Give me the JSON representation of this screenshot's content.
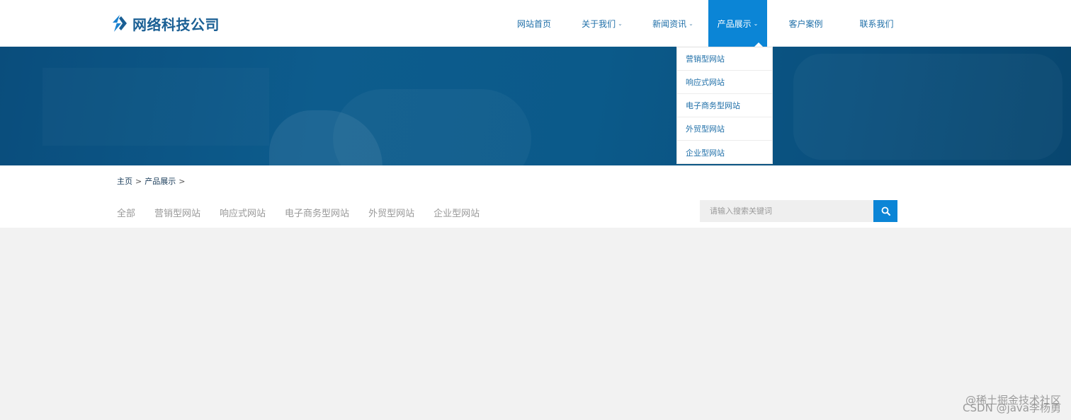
{
  "header": {
    "logo_text": "网络科技公司",
    "nav": [
      {
        "label": "网站首页",
        "chevron": false,
        "active": false
      },
      {
        "label": "关于我们",
        "chevron": true,
        "active": false
      },
      {
        "label": "新闻资讯",
        "chevron": true,
        "active": false
      },
      {
        "label": "产品展示",
        "chevron": true,
        "active": true
      },
      {
        "label": "客户案例",
        "chevron": false,
        "active": false
      },
      {
        "label": "联系我们",
        "chevron": false,
        "active": false
      }
    ],
    "chevron_glyph": "⌄"
  },
  "dropdown": {
    "items": [
      "营销型网站",
      "响应式网站",
      "电子商务型网站",
      "外贸型网站",
      "企业型网站"
    ]
  },
  "breadcrumb": {
    "home": "主页",
    "current": "产品展示",
    "separator": ">"
  },
  "categories": [
    "全部",
    "营销型网站",
    "响应式网站",
    "电子商务型网站",
    "外贸型网站",
    "企业型网站"
  ],
  "search": {
    "placeholder": "请输入搜索关键词",
    "value": ""
  },
  "watermark": {
    "line1": "@稀土掘金技术社区",
    "line2": "CSDN @java李杨勇"
  },
  "colors": {
    "accent": "#0b85d6",
    "nav_text": "#1f6fa8",
    "banner": "#0a4f7d",
    "logo": "#1a5f94"
  }
}
